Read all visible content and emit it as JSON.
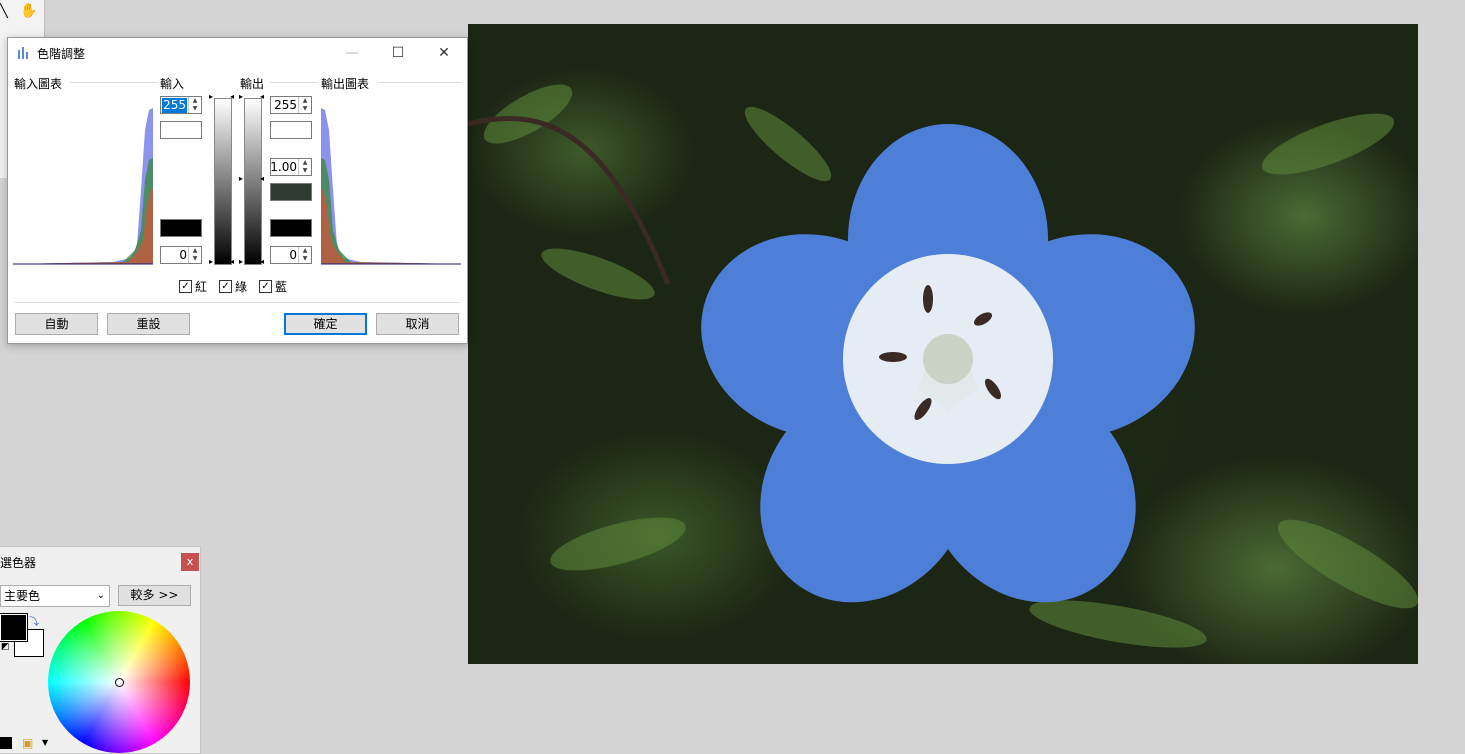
{
  "levels_dialog": {
    "title": "色階調整",
    "input_histogram_label": "輸入圖表",
    "input_label": "輸入",
    "output_label": "輸出",
    "output_histogram_label": "輸出圖表",
    "input_high": "255",
    "input_low": "0",
    "output_high": "255",
    "output_gamma": "1.00",
    "output_low": "0",
    "checkbox_red": "紅",
    "checkbox_green": "綠",
    "checkbox_blue": "藍",
    "auto_button": "自動",
    "reset_button": "重設",
    "ok_button": "確定",
    "cancel_button": "取消",
    "colors": {
      "gamma_swatch": "#2e3a32",
      "black_swatch": "#000000",
      "accent": "#0078d7"
    }
  },
  "color_picker": {
    "title": "選色器",
    "close": "x",
    "mode_select": "主要色",
    "more_button": "較多 >>"
  }
}
